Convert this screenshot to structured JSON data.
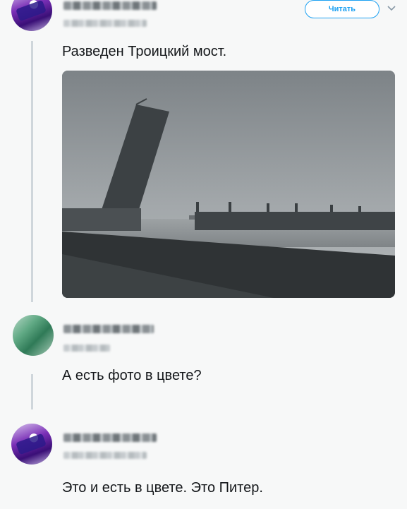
{
  "tweet": {
    "follow_label": "Читать",
    "text": "Разведен Троицкий мост."
  },
  "reply1": {
    "text": "А есть фото в цвете?"
  },
  "reply2": {
    "text": "Это и есть в цвете. Это Питер."
  },
  "icons": {
    "chevron": "chevron-down-icon"
  },
  "colors": {
    "accent": "#1da1f2",
    "text": "#14171a",
    "thread_line": "#cfd6db"
  }
}
